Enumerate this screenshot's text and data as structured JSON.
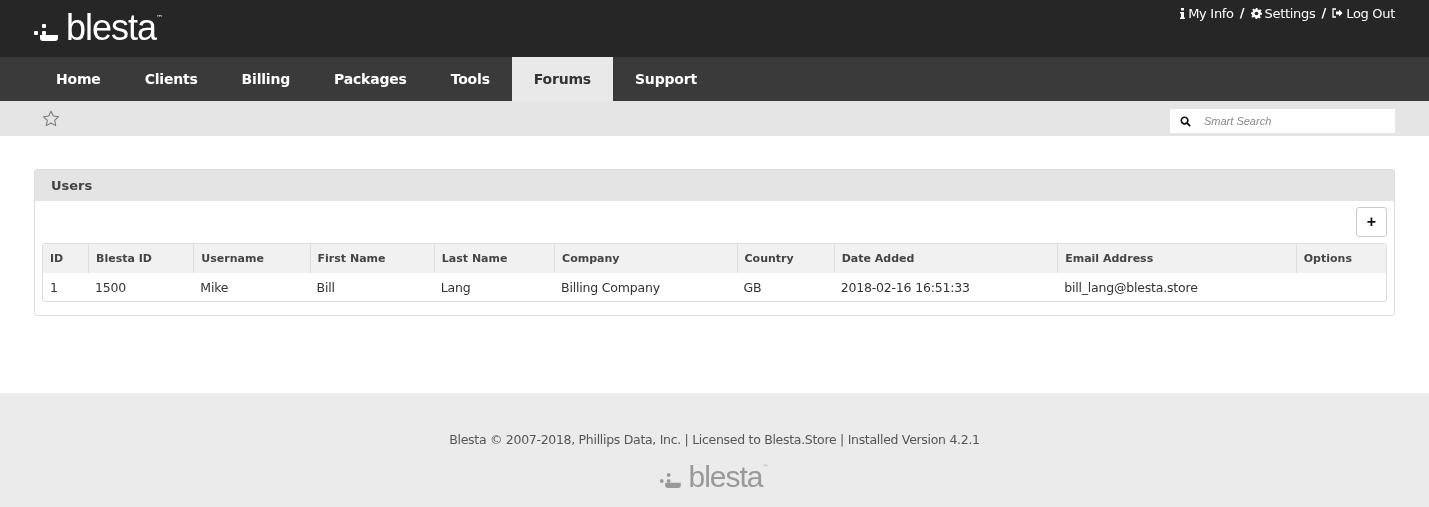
{
  "header": {
    "logo_text": "blesta",
    "logo_mark": "™",
    "links": [
      {
        "kind": "info",
        "label": "My Info"
      },
      {
        "kind": "settings",
        "label": "Settings"
      },
      {
        "kind": "logout",
        "label": "Log Out"
      }
    ],
    "separator": "/"
  },
  "nav": [
    {
      "label": "Home",
      "selected": false
    },
    {
      "label": "Clients",
      "selected": false
    },
    {
      "label": "Billing",
      "selected": false
    },
    {
      "label": "Packages",
      "selected": false
    },
    {
      "label": "Tools",
      "selected": false
    },
    {
      "label": "Forums",
      "selected": true
    },
    {
      "label": "Support",
      "selected": false
    }
  ],
  "search": {
    "placeholder": "Smart Search"
  },
  "panel": {
    "title": "Users",
    "add_button": "+",
    "table": {
      "columns": [
        "ID",
        "Blesta ID",
        "Username",
        "First Name",
        "Last Name",
        "Company",
        "Country",
        "Date Added",
        "Email Address",
        "Options"
      ],
      "rows": [
        [
          "1",
          "1500",
          "Mike",
          "Bill",
          "Lang",
          "Billing Company",
          "GB",
          "2018-02-16 16:51:33",
          "bill_lang@blesta.store",
          null
        ]
      ]
    }
  },
  "footer": {
    "text": "Blesta © 2007-2018, Phillips Data, Inc. | Licensed to Blesta.Store | Installed Version 4.2.1",
    "logo_text": "blesta",
    "logo_mark": "™"
  }
}
